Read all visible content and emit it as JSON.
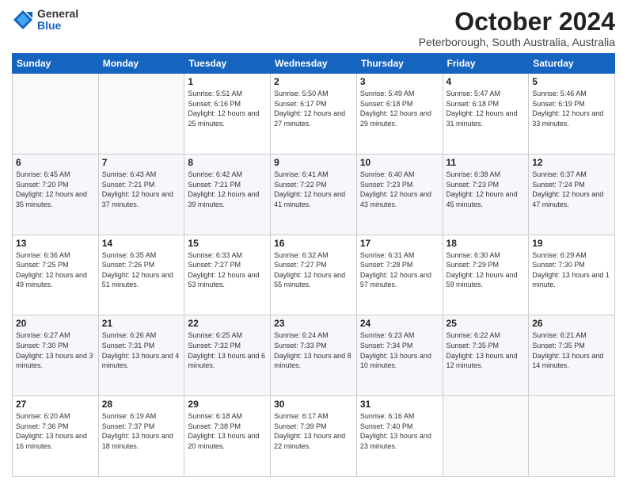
{
  "logo": {
    "general": "General",
    "blue": "Blue"
  },
  "title": "October 2024",
  "subtitle": "Peterborough, South Australia, Australia",
  "days_of_week": [
    "Sunday",
    "Monday",
    "Tuesday",
    "Wednesday",
    "Thursday",
    "Friday",
    "Saturday"
  ],
  "weeks": [
    [
      {
        "day": "",
        "info": ""
      },
      {
        "day": "",
        "info": ""
      },
      {
        "day": "1",
        "info": "Sunrise: 5:51 AM\nSunset: 6:16 PM\nDaylight: 12 hours and 25 minutes."
      },
      {
        "day": "2",
        "info": "Sunrise: 5:50 AM\nSunset: 6:17 PM\nDaylight: 12 hours and 27 minutes."
      },
      {
        "day": "3",
        "info": "Sunrise: 5:49 AM\nSunset: 6:18 PM\nDaylight: 12 hours and 29 minutes."
      },
      {
        "day": "4",
        "info": "Sunrise: 5:47 AM\nSunset: 6:18 PM\nDaylight: 12 hours and 31 minutes."
      },
      {
        "day": "5",
        "info": "Sunrise: 5:46 AM\nSunset: 6:19 PM\nDaylight: 12 hours and 33 minutes."
      }
    ],
    [
      {
        "day": "6",
        "info": "Sunrise: 6:45 AM\nSunset: 7:20 PM\nDaylight: 12 hours and 35 minutes."
      },
      {
        "day": "7",
        "info": "Sunrise: 6:43 AM\nSunset: 7:21 PM\nDaylight: 12 hours and 37 minutes."
      },
      {
        "day": "8",
        "info": "Sunrise: 6:42 AM\nSunset: 7:21 PM\nDaylight: 12 hours and 39 minutes."
      },
      {
        "day": "9",
        "info": "Sunrise: 6:41 AM\nSunset: 7:22 PM\nDaylight: 12 hours and 41 minutes."
      },
      {
        "day": "10",
        "info": "Sunrise: 6:40 AM\nSunset: 7:23 PM\nDaylight: 12 hours and 43 minutes."
      },
      {
        "day": "11",
        "info": "Sunrise: 6:38 AM\nSunset: 7:23 PM\nDaylight: 12 hours and 45 minutes."
      },
      {
        "day": "12",
        "info": "Sunrise: 6:37 AM\nSunset: 7:24 PM\nDaylight: 12 hours and 47 minutes."
      }
    ],
    [
      {
        "day": "13",
        "info": "Sunrise: 6:36 AM\nSunset: 7:25 PM\nDaylight: 12 hours and 49 minutes."
      },
      {
        "day": "14",
        "info": "Sunrise: 6:35 AM\nSunset: 7:26 PM\nDaylight: 12 hours and 51 minutes."
      },
      {
        "day": "15",
        "info": "Sunrise: 6:33 AM\nSunset: 7:27 PM\nDaylight: 12 hours and 53 minutes."
      },
      {
        "day": "16",
        "info": "Sunrise: 6:32 AM\nSunset: 7:27 PM\nDaylight: 12 hours and 55 minutes."
      },
      {
        "day": "17",
        "info": "Sunrise: 6:31 AM\nSunset: 7:28 PM\nDaylight: 12 hours and 57 minutes."
      },
      {
        "day": "18",
        "info": "Sunrise: 6:30 AM\nSunset: 7:29 PM\nDaylight: 12 hours and 59 minutes."
      },
      {
        "day": "19",
        "info": "Sunrise: 6:29 AM\nSunset: 7:30 PM\nDaylight: 13 hours and 1 minute."
      }
    ],
    [
      {
        "day": "20",
        "info": "Sunrise: 6:27 AM\nSunset: 7:30 PM\nDaylight: 13 hours and 3 minutes."
      },
      {
        "day": "21",
        "info": "Sunrise: 6:26 AM\nSunset: 7:31 PM\nDaylight: 13 hours and 4 minutes."
      },
      {
        "day": "22",
        "info": "Sunrise: 6:25 AM\nSunset: 7:32 PM\nDaylight: 13 hours and 6 minutes."
      },
      {
        "day": "23",
        "info": "Sunrise: 6:24 AM\nSunset: 7:33 PM\nDaylight: 13 hours and 8 minutes."
      },
      {
        "day": "24",
        "info": "Sunrise: 6:23 AM\nSunset: 7:34 PM\nDaylight: 13 hours and 10 minutes."
      },
      {
        "day": "25",
        "info": "Sunrise: 6:22 AM\nSunset: 7:35 PM\nDaylight: 13 hours and 12 minutes."
      },
      {
        "day": "26",
        "info": "Sunrise: 6:21 AM\nSunset: 7:35 PM\nDaylight: 13 hours and 14 minutes."
      }
    ],
    [
      {
        "day": "27",
        "info": "Sunrise: 6:20 AM\nSunset: 7:36 PM\nDaylight: 13 hours and 16 minutes."
      },
      {
        "day": "28",
        "info": "Sunrise: 6:19 AM\nSunset: 7:37 PM\nDaylight: 13 hours and 18 minutes."
      },
      {
        "day": "29",
        "info": "Sunrise: 6:18 AM\nSunset: 7:38 PM\nDaylight: 13 hours and 20 minutes."
      },
      {
        "day": "30",
        "info": "Sunrise: 6:17 AM\nSunset: 7:39 PM\nDaylight: 13 hours and 22 minutes."
      },
      {
        "day": "31",
        "info": "Sunrise: 6:16 AM\nSunset: 7:40 PM\nDaylight: 13 hours and 23 minutes."
      },
      {
        "day": "",
        "info": ""
      },
      {
        "day": "",
        "info": ""
      }
    ]
  ]
}
